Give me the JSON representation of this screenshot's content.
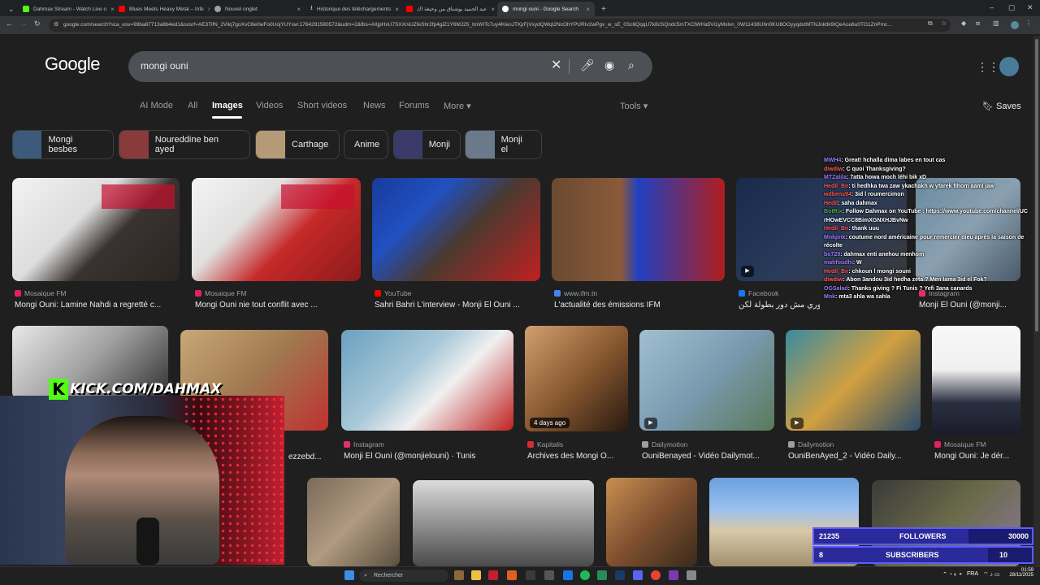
{
  "browser": {
    "tabs": [
      {
        "title": "Dahmax Stream - Watch Live o",
        "active": false,
        "color": "#53fc18"
      },
      {
        "title": "Blues Meets Heavy Metal – Infe",
        "active": false,
        "color": "#ff0000"
      },
      {
        "title": "Nouvel onglet",
        "active": false,
        "color": "#9aa0a6"
      },
      {
        "title": "Historique des téléchargements",
        "active": false,
        "color": "#9aa0a6"
      },
      {
        "title": "عبد الحميد بوشناق من وحيغة اك",
        "active": false,
        "color": "#ff0000"
      },
      {
        "title": "mongi ouni - Google Search",
        "active": true,
        "color": "#4285f4"
      }
    ],
    "url": "google.com/search?sca_esv=99ba87713a6b4ed1&sxsrf=AE3TifN_2Vilq7goXvC6e0wFo0UojYUYxw:1764291580572&udm=2&fbs=AIIjpHxU7SXXniUZfeShr2fp4giZ1Y6MJ25_tmWITc7uy4KleoJTKjrFjVxydQWqI2NcOhYPURIv2wPgv_w_sE_0Sc6QqqU7k8cSQndc5mTXClWHa5Vi1yMxlvn_0W11438Uhn0KU8OOyyqdxtMTNJnktlk9IQeAou6u0TG1ZnPmc..."
  },
  "google": {
    "logo": "Google",
    "query": "mongi ouni",
    "nav": [
      "AI Mode",
      "All",
      "Images",
      "Videos",
      "Short videos",
      "News",
      "Forums",
      "More"
    ],
    "nav_active": "Images",
    "tools": "Tools",
    "saves": "Saves",
    "chips": [
      "Mongi besbes",
      "Noureddine ben ayed",
      "Carthage",
      "Anime",
      "Monji",
      "Monji el"
    ]
  },
  "results": [
    {
      "source": "Mosaique FM",
      "title": "Mongi Ouni: Lamine Nahdi a regretté c...",
      "src_color": "#e91e63"
    },
    {
      "source": "Mosaique FM",
      "title": "Mongi Ouni nie tout conflit avec ...",
      "src_color": "#e91e63"
    },
    {
      "source": "YouTube",
      "title": "Sahri Bahri L'interview - Monji El Ouni ...",
      "src_color": "#ff0000"
    },
    {
      "source": "www.ifm.tn",
      "title": "L'actualité des émissions IFM",
      "src_color": "#4285f4"
    },
    {
      "source": "Facebook",
      "title": "دوري مش دور بطولة لكن ...",
      "src_color": "#1877f2"
    },
    {
      "source": "Instagram",
      "title": "Monji El Ouni (@monji...",
      "src_color": "#e1306c"
    },
    {
      "source": "",
      "title": "ezzebd...",
      "src_color": "#9aa0a6"
    },
    {
      "source": "Instagram",
      "title": "Monji El Ouni (@monjielouni) · Tunis",
      "src_color": "#e1306c"
    },
    {
      "source": "Kapitalis",
      "title": "Archives des Mongi O...",
      "src_color": "#d32f2f",
      "badge": "4 days ago"
    },
    {
      "source": "Dailymotion",
      "title": "OuniBenayed - Vidéo Dailymot...",
      "src_color": "#9aa0a6"
    },
    {
      "source": "Dailymotion",
      "title": "OuniBenAyed_2 - Vidéo Daily...",
      "src_color": "#9aa0a6"
    },
    {
      "source": "Mosaique FM",
      "title": "Mongi Ouni: Je dér...",
      "src_color": "#e91e63"
    }
  ],
  "overlay": {
    "kick": "KICK.COM/DAHMAX",
    "chat": [
      {
        "user": "MWH4",
        "msg": ": Great! hchalla dima labes en tout cas",
        "cls": ""
      },
      {
        "user": "diwdiw",
        "msg": ": C quoi Thanksgiving?",
        "cls": "r"
      },
      {
        "user": "MTZalila",
        "msg": ": 7atta howa moch léhi bik xD",
        "cls": ""
      },
      {
        "user": "Hedil_Bn",
        "msg": ": ti hedhka twa zaw ykachakh w yfarek fihom aaml jaw",
        "cls": "r"
      },
      {
        "user": "wdbens94",
        "msg": ": 3id l roumercimon",
        "cls": "r"
      },
      {
        "user": "Hedil",
        "msg": ": saha dahmax",
        "cls": "r"
      },
      {
        "user": "BotRix",
        "msg": ": Follow Dahmax on YouTube : https://www.youtube.com/channel/UCrHOwEVCC8BimXGNXHJBvNw",
        "cls": "g"
      },
      {
        "user": "Hedil_Bn",
        "msg": ": thank uuu",
        "cls": "r"
      },
      {
        "user": "Mnkpnk",
        "msg": ": coutume nord américaine pour remercier dieu après la saison de récolte",
        "cls": ""
      },
      {
        "user": "bo729",
        "msg": ": dahmax enti anehou menhom",
        "cls": ""
      },
      {
        "user": "mahfoudhi",
        "msg": ": W",
        "cls": ""
      },
      {
        "user": "Hedil_Bn",
        "msg": ": chkoun l mongi souni",
        "cls": "r"
      },
      {
        "user": "diwdiw",
        "msg": ": Abon 3andou 3id hedha zeta ? Men lama 3id el Fok?",
        "cls": "r"
      },
      {
        "user": "OGSalad",
        "msg": ": Thanks giving ? Fi Tunis ? Yefi 3ana canards",
        "cls": ""
      },
      {
        "user": "Mnk",
        "msg": ": mta3 ahla wa sahla",
        "cls": ""
      }
    ],
    "followers_value": "21235",
    "followers_label": "FOLLOWERS",
    "followers_goal": "30000",
    "followers_progress": 0.708,
    "subscribers_value": "8",
    "subscribers_label": "SUBSCRIBERS",
    "subscribers_goal": "10",
    "subscribers_progress": 0.8
  },
  "taskbar": {
    "search_placeholder": "Rechercher",
    "lang": "FRA",
    "time": "01:59",
    "date": "28/11/2025"
  },
  "colors": {
    "accent": "#8ab4f8",
    "kick": "#53fc18",
    "stat_bg": "#1a1b6e"
  }
}
